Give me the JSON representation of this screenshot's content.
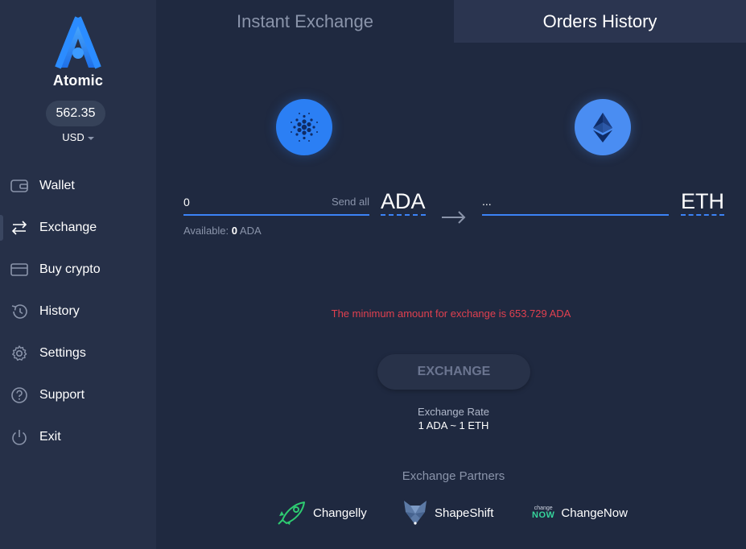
{
  "app": {
    "name": "Atomic"
  },
  "sidebar": {
    "balance": "562.35",
    "currency": "USD",
    "items": [
      {
        "label": "Wallet",
        "icon": "wallet-icon"
      },
      {
        "label": "Exchange",
        "icon": "exchange-arrows-icon",
        "active": true
      },
      {
        "label": "Buy crypto",
        "icon": "credit-card-icon"
      },
      {
        "label": "History",
        "icon": "history-clock-icon"
      },
      {
        "label": "Settings",
        "icon": "gear-icon"
      },
      {
        "label": "Support",
        "icon": "question-icon"
      },
      {
        "label": "Exit",
        "icon": "power-icon"
      }
    ]
  },
  "tabs": [
    {
      "label": "Instant Exchange"
    },
    {
      "label": "Orders History",
      "selected": true
    }
  ],
  "exchange": {
    "from": {
      "amount": "0",
      "send_all": "Send all",
      "code": "ADA",
      "icon": "cardano-icon",
      "available_label": "Available:",
      "available_amount": "0",
      "available_code": "ADA"
    },
    "to": {
      "amount": "...",
      "code": "ETH",
      "icon": "ethereum-icon"
    },
    "warning": "The minimum amount for exchange is 653.729 ADA",
    "button": "EXCHANGE",
    "rate_label": "Exchange Rate",
    "rate_value": "1 ADA ~ 1 ETH"
  },
  "partners": {
    "title": "Exchange Partners",
    "items": [
      {
        "name": "Changelly",
        "icon": "changelly-rocket-icon"
      },
      {
        "name": "ShapeShift",
        "icon": "shapeshift-fox-icon"
      },
      {
        "name": "ChangeNow",
        "icon": "changenow-logo",
        "logo_small": "change",
        "logo_big": "NOW"
      }
    ]
  },
  "colors": {
    "background": "#1f2940",
    "sidebar": "#263048",
    "accent": "#3b82f6",
    "warning": "#e0404f"
  }
}
